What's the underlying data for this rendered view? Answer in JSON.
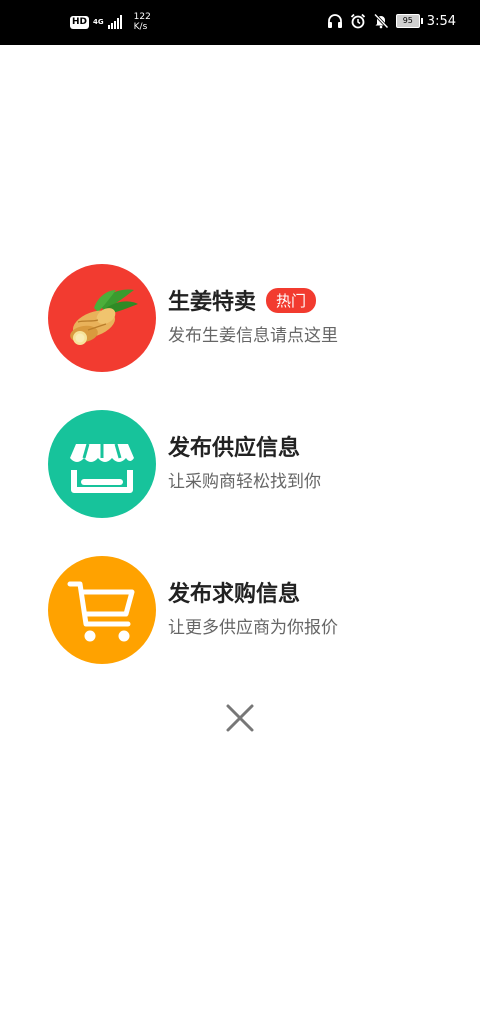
{
  "status_bar": {
    "hd": "HD",
    "network": "4G",
    "speed_value": "122",
    "speed_unit": "K/s",
    "battery": "95",
    "time": "3:54"
  },
  "menu": {
    "items": [
      {
        "title": "生姜特卖",
        "badge": "热门",
        "subtitle": "发布生姜信息请点这里",
        "icon": "ginger-icon",
        "color": "#f23b30"
      },
      {
        "title": "发布供应信息",
        "subtitle": "让采购商轻松找到你",
        "icon": "storefront-icon",
        "color": "#17c39b"
      },
      {
        "title": "发布求购信息",
        "subtitle": "让更多供应商为你报价",
        "icon": "shopping-cart-icon",
        "color": "#ffa200"
      }
    ]
  },
  "close": {
    "icon": "close-icon"
  }
}
